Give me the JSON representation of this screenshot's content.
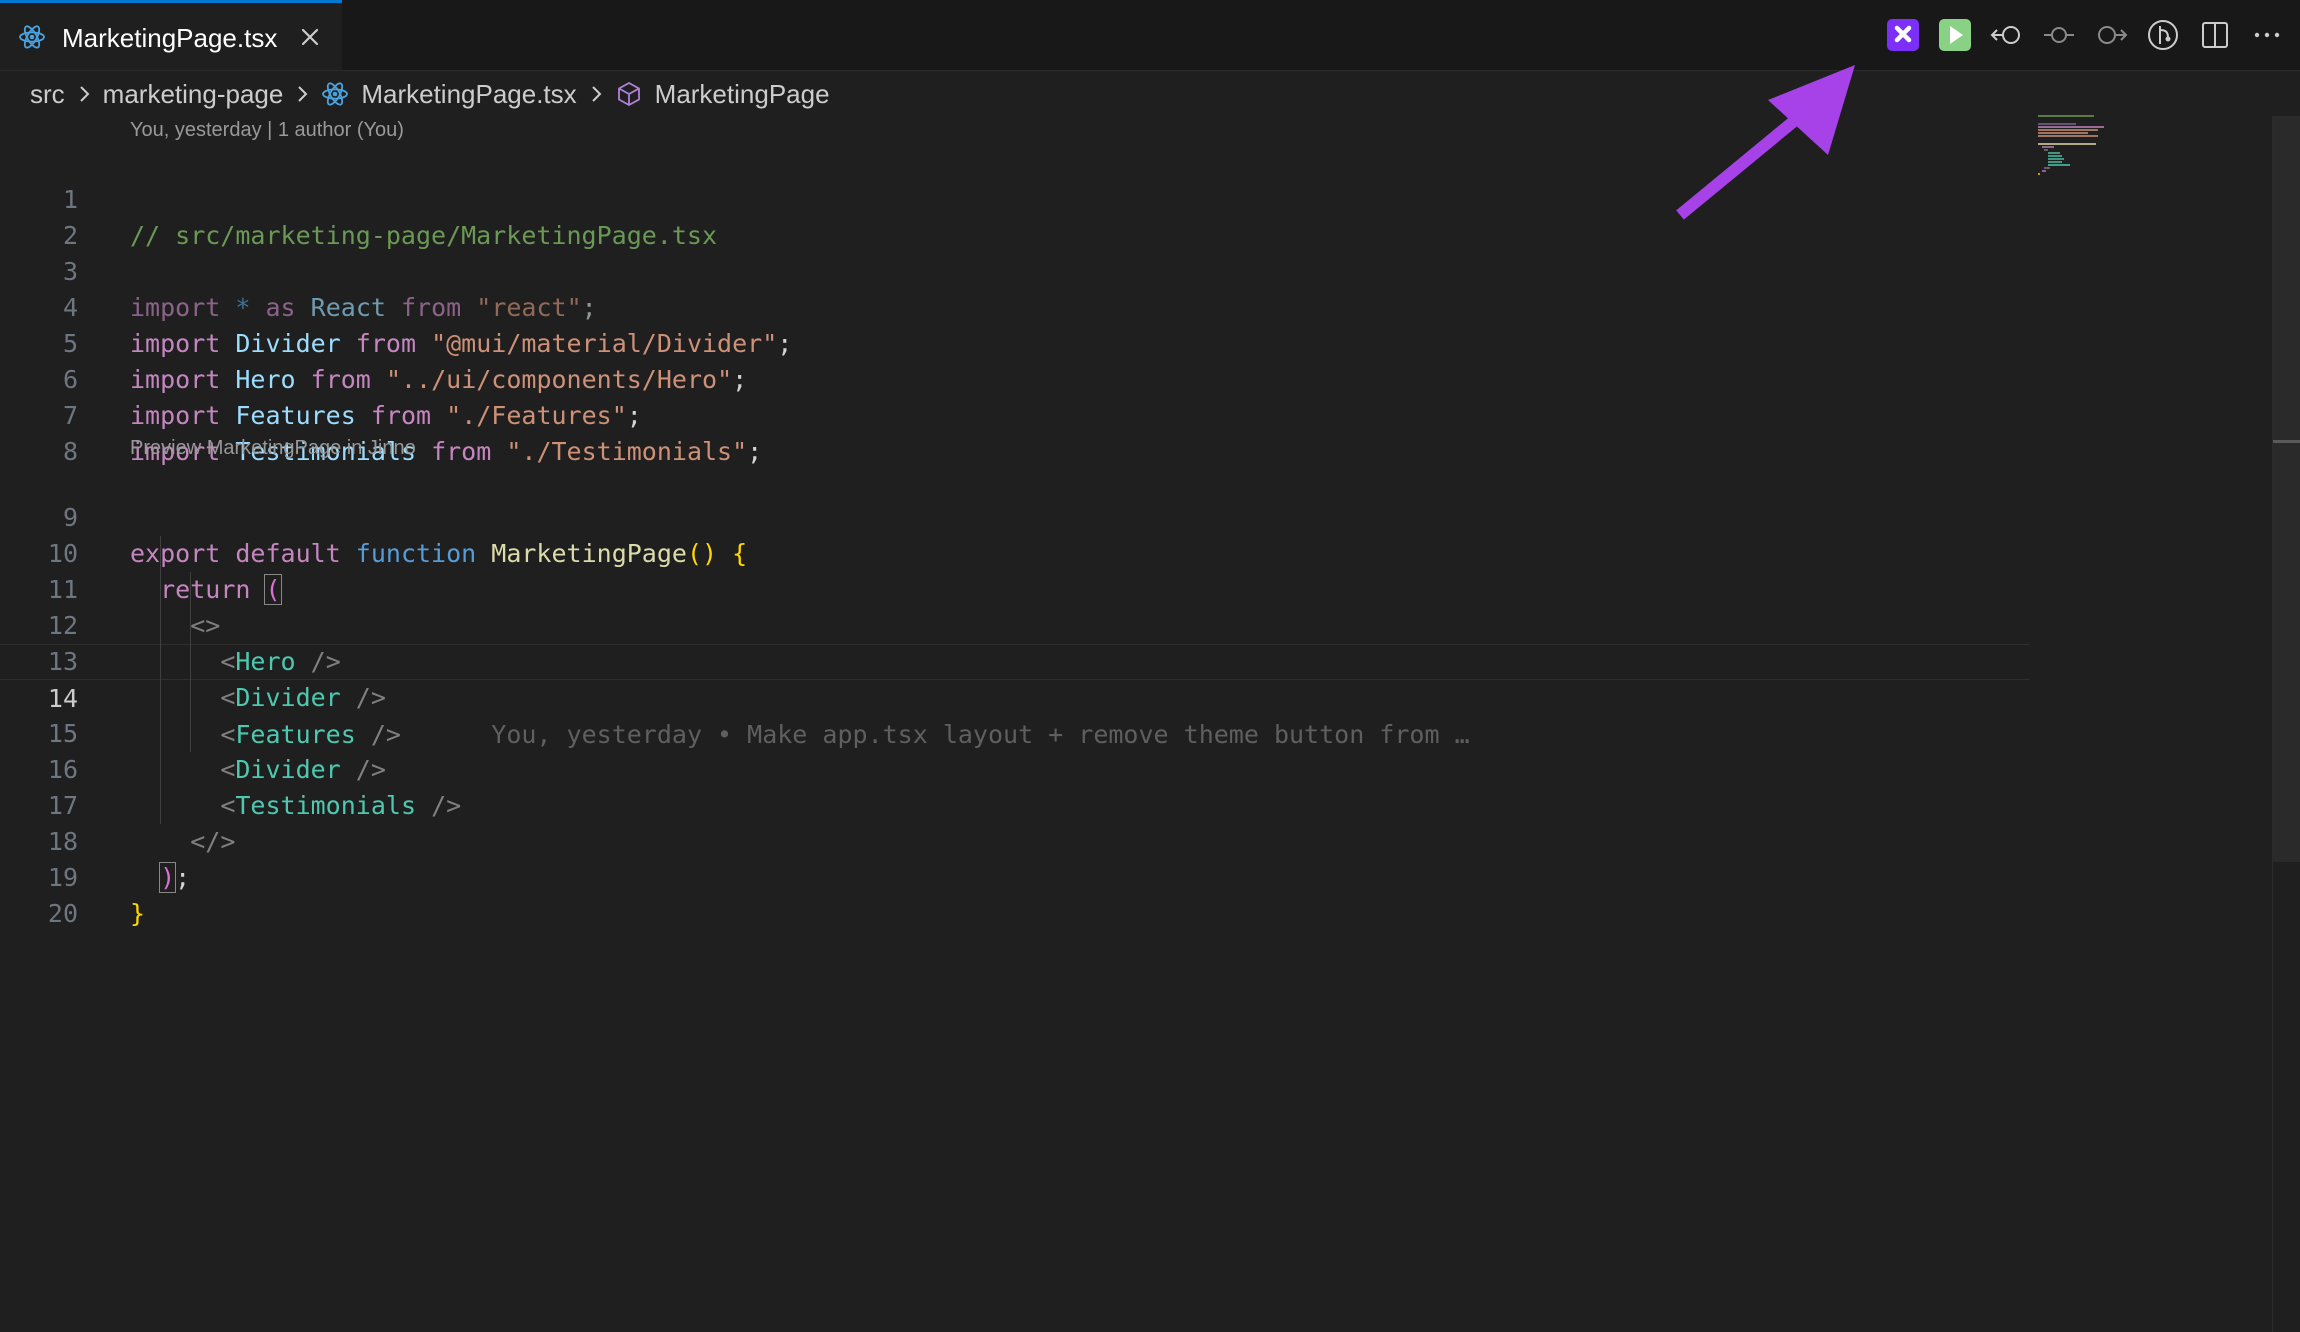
{
  "tab": {
    "label": "MarketingPage.tsx",
    "icon": "react-icon",
    "close_icon": "close-icon"
  },
  "toolbar": {
    "actions": [
      {
        "name": "jinno-icon",
        "color": "#7b2ff7"
      },
      {
        "name": "run-icon",
        "color": "#89d185"
      },
      {
        "name": "go-back-icon"
      },
      {
        "name": "commit-icon"
      },
      {
        "name": "go-forward-icon"
      },
      {
        "name": "git-compare-icon"
      },
      {
        "name": "split-editor-icon"
      },
      {
        "name": "more-actions-icon"
      }
    ]
  },
  "breadcrumb": {
    "items": [
      "src",
      "marketing-page",
      "MarketingPage.tsx",
      "MarketingPage"
    ]
  },
  "editor": {
    "codelens_blame": "You, yesterday | 1 author (You)",
    "codelens_preview": "Preview MarketingPage in Jinno",
    "current_line": 14,
    "inline_blame": "You, yesterday • Make app.tsx layout + remove theme button from …",
    "line_numbers": [
      "1",
      "2",
      "3",
      "4",
      "5",
      "6",
      "7",
      "8",
      "9",
      "10",
      "11",
      "12",
      "13",
      "14",
      "15",
      "16",
      "17",
      "18",
      "19",
      "20"
    ],
    "tokens": {
      "l1_comment": "// src/marketing-page/MarketingPage.tsx",
      "import": "import",
      "star": "*",
      "as": "as",
      "from": "from",
      "react_ident": "React",
      "react_str": "\"react\"",
      "divider_ident": "Divider",
      "divider_str": "\"@mui/material/Divider\"",
      "hero_ident": "Hero",
      "hero_str": "\"../ui/components/Hero\"",
      "features_ident": "Features",
      "features_str": "\"./Features\"",
      "testimonials_ident": "Testimonials",
      "testimonials_str": "\"./Testimonials\"",
      "semicolon": ";",
      "export": "export",
      "default": "default",
      "function": "function",
      "fn_name": "MarketingPage",
      "parens": "()",
      "open_brace": "{",
      "close_brace": "}",
      "return": "return",
      "open_paren": "(",
      "close_paren": ")",
      "frag_open": "<>",
      "frag_close": "</>",
      "lt": "<",
      "self_close": "/>",
      "tag_hero": "Hero",
      "tag_divider": "Divider",
      "tag_features": "Features",
      "tag_testimonials": "Testimonials"
    }
  }
}
